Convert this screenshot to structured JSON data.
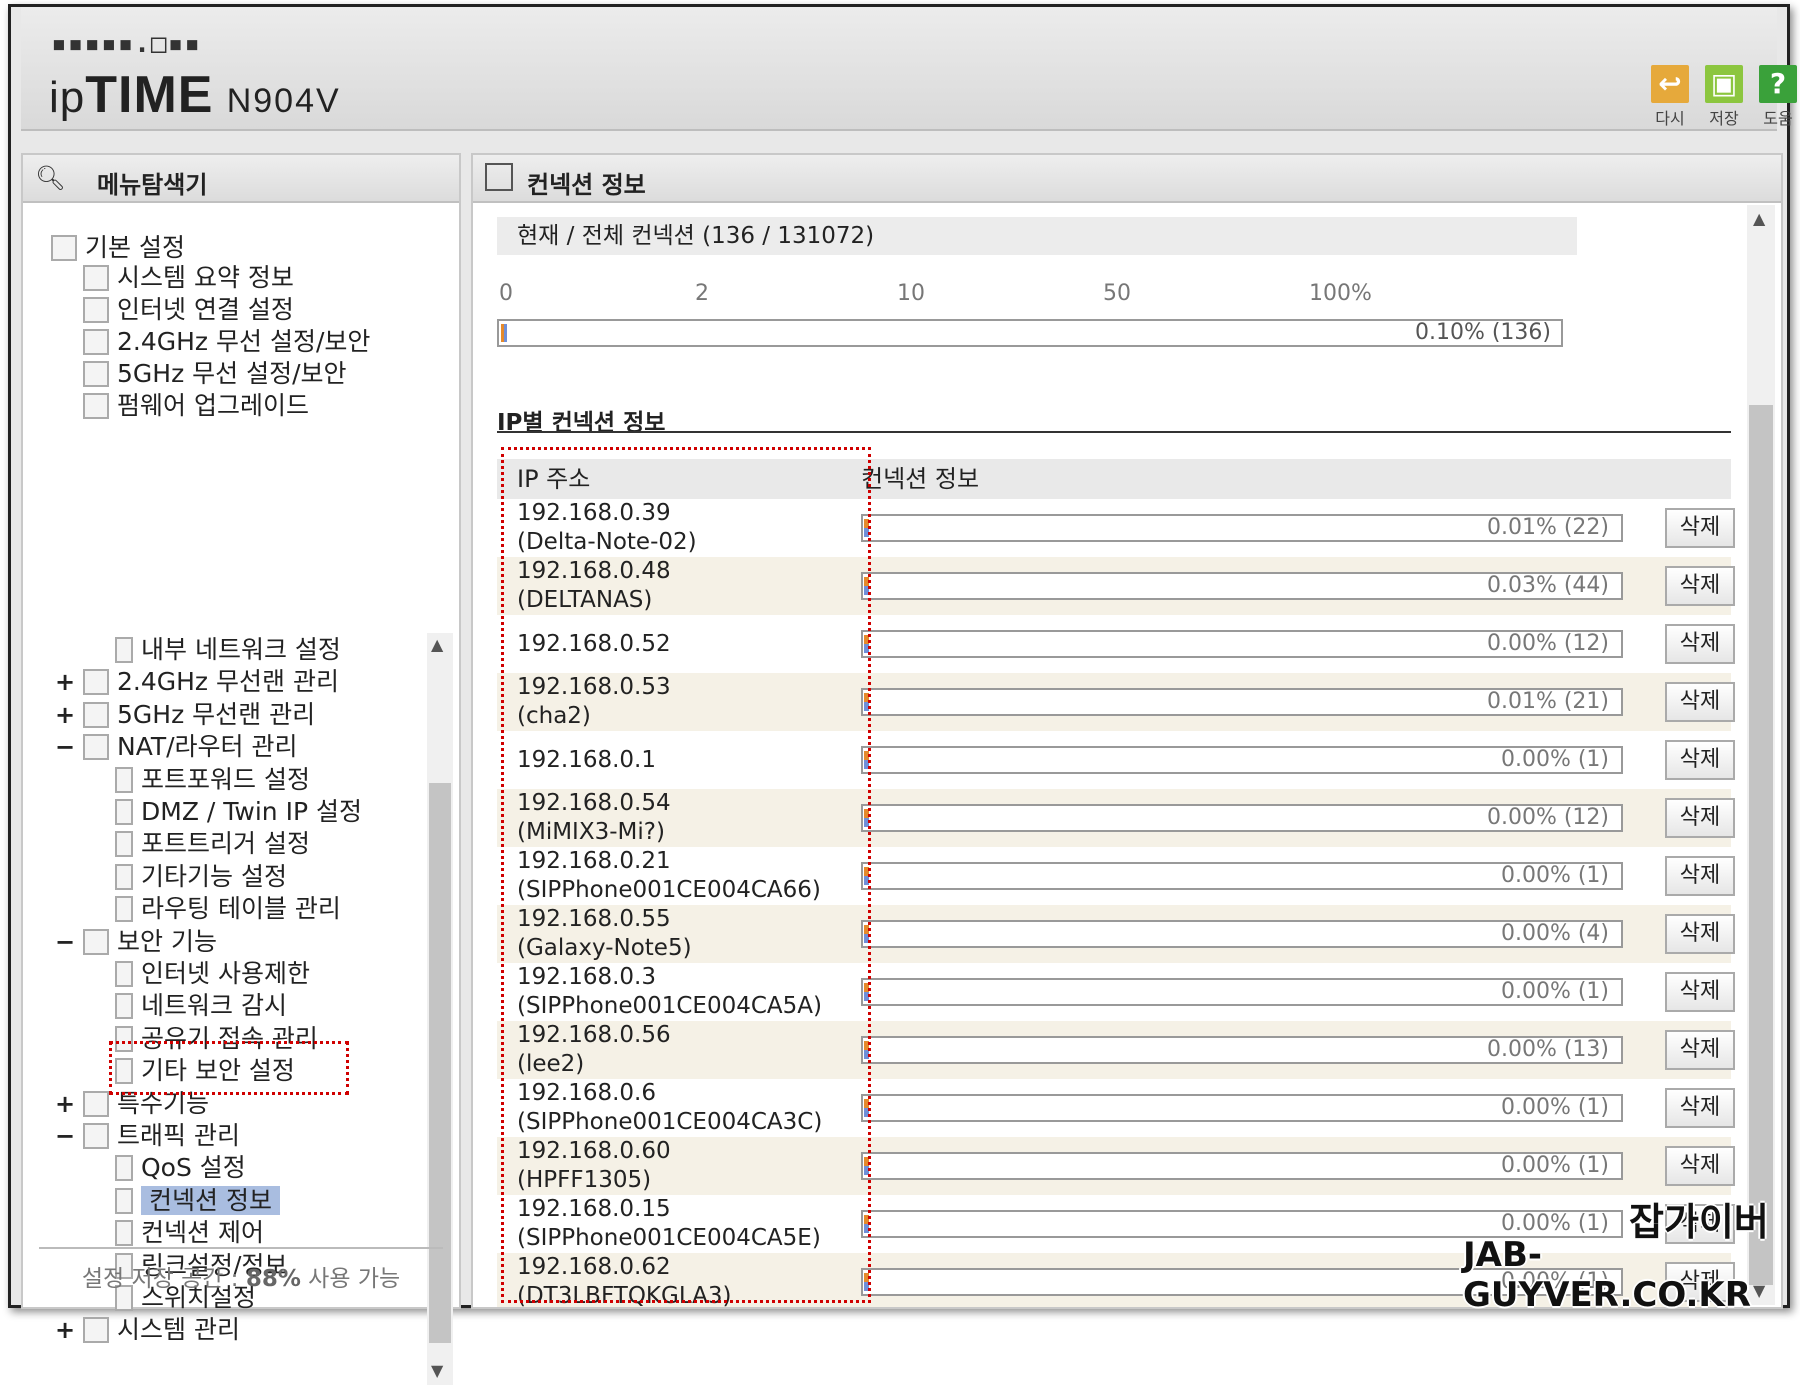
{
  "header": {
    "logo_dots": "▪▪▪▪▪.□▪▪",
    "brand_prefix": "ip",
    "brand_main": "TIME",
    "model": "N904V",
    "tools": [
      {
        "label": "다시",
        "icon": "undo-icon",
        "color": "#e6a93b"
      },
      {
        "label": "저장",
        "icon": "save-icon",
        "color": "#8cc63f"
      },
      {
        "label": "도움",
        "icon": "help-icon",
        "color": "#3aa13a"
      }
    ]
  },
  "left": {
    "title": "메뉴탐색기",
    "top_group": {
      "label": "기본 설정",
      "items": [
        "시스템 요약 정보",
        "인터넷 연결 설정",
        "2.4GHz 무선 설정/보안",
        "5GHz 무선 설정/보안",
        "펌웨어 업그레이드"
      ]
    },
    "tree": [
      {
        "label": "내부 네트워크 설정",
        "level": 2,
        "exp": ""
      },
      {
        "label": "2.4GHz 무선랜 관리",
        "level": 1,
        "exp": "+"
      },
      {
        "label": "5GHz 무선랜 관리",
        "level": 1,
        "exp": "+"
      },
      {
        "label": "NAT/라우터 관리",
        "level": 1,
        "exp": "−"
      },
      {
        "label": "포트포워드 설정",
        "level": 2,
        "exp": ""
      },
      {
        "label": "DMZ / Twin IP 설정",
        "level": 2,
        "exp": ""
      },
      {
        "label": "포트트리거 설정",
        "level": 2,
        "exp": ""
      },
      {
        "label": "기타기능 설정",
        "level": 2,
        "exp": ""
      },
      {
        "label": "라우팅 테이블 관리",
        "level": 2,
        "exp": ""
      },
      {
        "label": "보안 기능",
        "level": 1,
        "exp": "−"
      },
      {
        "label": "인터넷 사용제한",
        "level": 2,
        "exp": ""
      },
      {
        "label": "네트워크 감시",
        "level": 2,
        "exp": ""
      },
      {
        "label": "공유기 접속 관리",
        "level": 2,
        "exp": ""
      },
      {
        "label": "기타 보안 설정",
        "level": 2,
        "exp": ""
      },
      {
        "label": "특수기능",
        "level": 1,
        "exp": "+"
      },
      {
        "label": "트래픽 관리",
        "level": 1,
        "exp": "−"
      },
      {
        "label": "QoS 설정",
        "level": 2,
        "exp": ""
      },
      {
        "label": "컨넥션 정보",
        "level": 2,
        "exp": "",
        "selected": true
      },
      {
        "label": "컨넥션 제어",
        "level": 2,
        "exp": ""
      },
      {
        "label": "링크설정/정보",
        "level": 2,
        "exp": ""
      },
      {
        "label": "스위치설정",
        "level": 2,
        "exp": ""
      },
      {
        "label": "시스템 관리",
        "level": 1,
        "exp": "+"
      }
    ],
    "storage_prefix": "설정 저장 공간 : ",
    "storage_value": "88%",
    "storage_suffix": " 사용 가능"
  },
  "main": {
    "title": "컨넥션 정보",
    "summary": "현재 / 전체 컨넥션 (136 / 131072)",
    "scale": [
      "0",
      "2",
      "10",
      "50",
      "100%"
    ],
    "total_text": "0.10% (136)",
    "total_fraction": 0.001,
    "section_title": "IP별 컨넥션 정보",
    "col_ip": "IP 주소",
    "col_info": "컨넥션 정보",
    "delete_label": "삭제",
    "rows": [
      {
        "ip": "192.168.0.39",
        "name": "(Delta-Note-02)",
        "pct": "0.01% (22)"
      },
      {
        "ip": "192.168.0.48",
        "name": "(DELTANAS)",
        "pct": "0.03% (44)"
      },
      {
        "ip": "192.168.0.52",
        "name": "",
        "pct": "0.00% (12)"
      },
      {
        "ip": "192.168.0.53",
        "name": "(cha2)",
        "pct": "0.01% (21)"
      },
      {
        "ip": "192.168.0.1",
        "name": "",
        "pct": "0.00% (1)"
      },
      {
        "ip": "192.168.0.54",
        "name": "(MiMIX3-Mi?)",
        "pct": "0.00% (12)"
      },
      {
        "ip": "192.168.0.21",
        "name": "(SIPPhone001CE004CA66)",
        "pct": "0.00% (1)"
      },
      {
        "ip": "192.168.0.55",
        "name": "(Galaxy-Note5)",
        "pct": "0.00% (4)"
      },
      {
        "ip": "192.168.0.3",
        "name": "(SIPPhone001CE004CA5A)",
        "pct": "0.00% (1)"
      },
      {
        "ip": "192.168.0.56",
        "name": "(lee2)",
        "pct": "0.00% (13)"
      },
      {
        "ip": "192.168.0.6",
        "name": "(SIPPhone001CE004CA3C)",
        "pct": "0.00% (1)"
      },
      {
        "ip": "192.168.0.60",
        "name": "(HPFF1305)",
        "pct": "0.00% (1)"
      },
      {
        "ip": "192.168.0.15",
        "name": "(SIPPhone001CE004CA5E)",
        "pct": "0.00% (1)"
      },
      {
        "ip": "192.168.0.62",
        "name": "(DT3LBFTQKGLA3)",
        "pct": "0.00% (1)"
      }
    ]
  },
  "watermark": {
    "line1": "잡가이버",
    "line2": "JAB-GUYVER.CO.KR"
  },
  "colors": {
    "selected_bg": "#a9bde0",
    "highlight_box": "#d00000",
    "row_alt": "#f5f1e6"
  }
}
